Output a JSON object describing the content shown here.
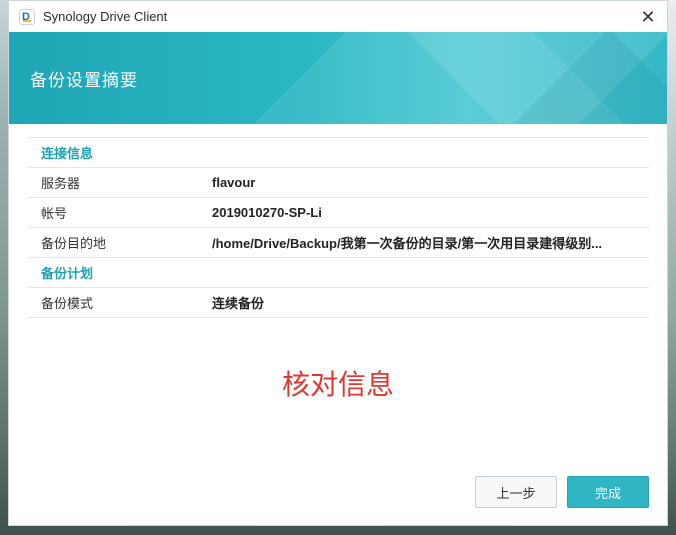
{
  "window": {
    "title": "Synology Drive Client",
    "close_symbol": "✕"
  },
  "header": {
    "title": "备份设置摘要"
  },
  "summary": {
    "connection_section": "连接信息",
    "connection_rows": [
      {
        "label": "服务器",
        "value": "flavour"
      },
      {
        "label": "帐号",
        "value": "2019010270-SP-Li"
      },
      {
        "label": "备份目的地",
        "value": "/home/Drive/Backup/我第一次备份的目录/第一次用目录建得级别..."
      }
    ],
    "plan_section": "备份计划",
    "plan_rows": [
      {
        "label": "备份模式",
        "value": "连续备份"
      }
    ]
  },
  "annotation": "核对信息",
  "buttons": {
    "prev": "上一步",
    "done": "完成"
  },
  "colors": {
    "accent": "#2fb5c4",
    "section_text": "#1aa2b3",
    "annotation": "#e0382f"
  }
}
